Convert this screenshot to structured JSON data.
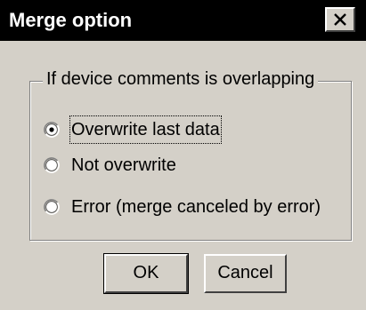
{
  "dialog": {
    "title": "Merge option",
    "close_icon": "close-icon"
  },
  "group": {
    "label": "If device comments is overlapping",
    "options": [
      {
        "label": "Overwrite last data",
        "selected": true
      },
      {
        "label": "Not overwrite",
        "selected": false
      },
      {
        "label": "Error (merge canceled by error)",
        "selected": false
      }
    ]
  },
  "buttons": {
    "ok_label": "OK",
    "cancel_label": "Cancel"
  }
}
